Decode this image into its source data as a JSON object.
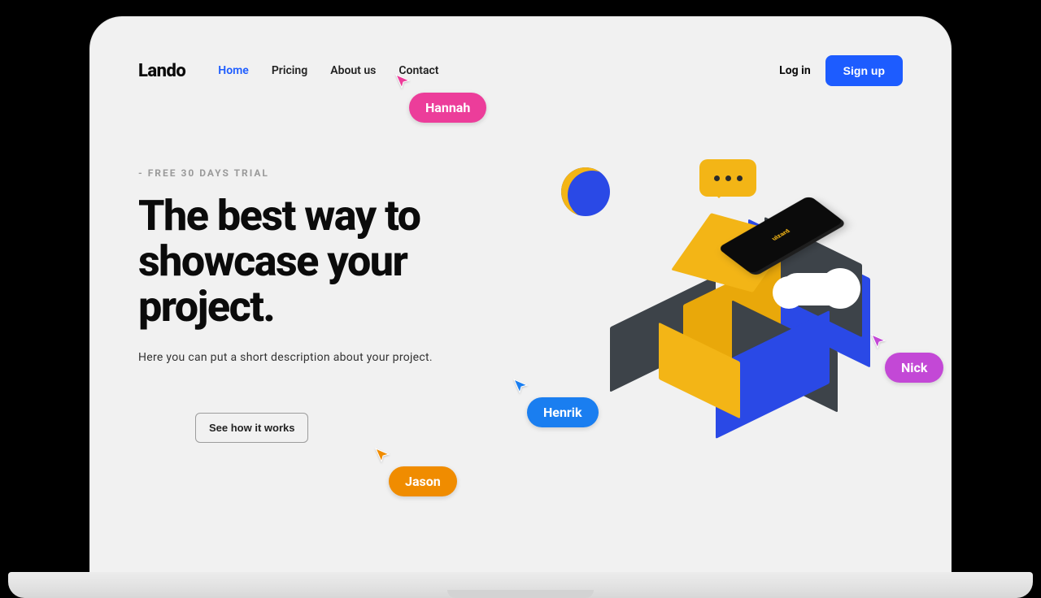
{
  "brand": {
    "name": "Lando"
  },
  "nav": {
    "items": [
      {
        "label": "Home",
        "active": true
      },
      {
        "label": "Pricing"
      },
      {
        "label": "About us"
      },
      {
        "label": "Contact"
      }
    ]
  },
  "auth": {
    "login_label": "Log in",
    "signup_label": "Sign up"
  },
  "hero": {
    "eyebrow": "- FREE 30 DAYS TRIAL",
    "headline": "The best way to showcase your project.",
    "subtext": "Here you can put a short description about your project.",
    "cta_label": "See how it works",
    "phone_brand": "uizard"
  },
  "cursors": {
    "hannah": {
      "name": "Hannah",
      "color": "#ec3d9a"
    },
    "henrik": {
      "name": "Henrik",
      "color": "#1a7ef0"
    },
    "jason": {
      "name": "Jason",
      "color": "#f08c00"
    },
    "nick": {
      "name": "Nick",
      "color": "#c348d6"
    }
  },
  "colors": {
    "primary": "#1d5cff",
    "accent_yellow": "#f3b516",
    "accent_blue": "#2a49e6",
    "neutral_dark": "#3d4349"
  }
}
